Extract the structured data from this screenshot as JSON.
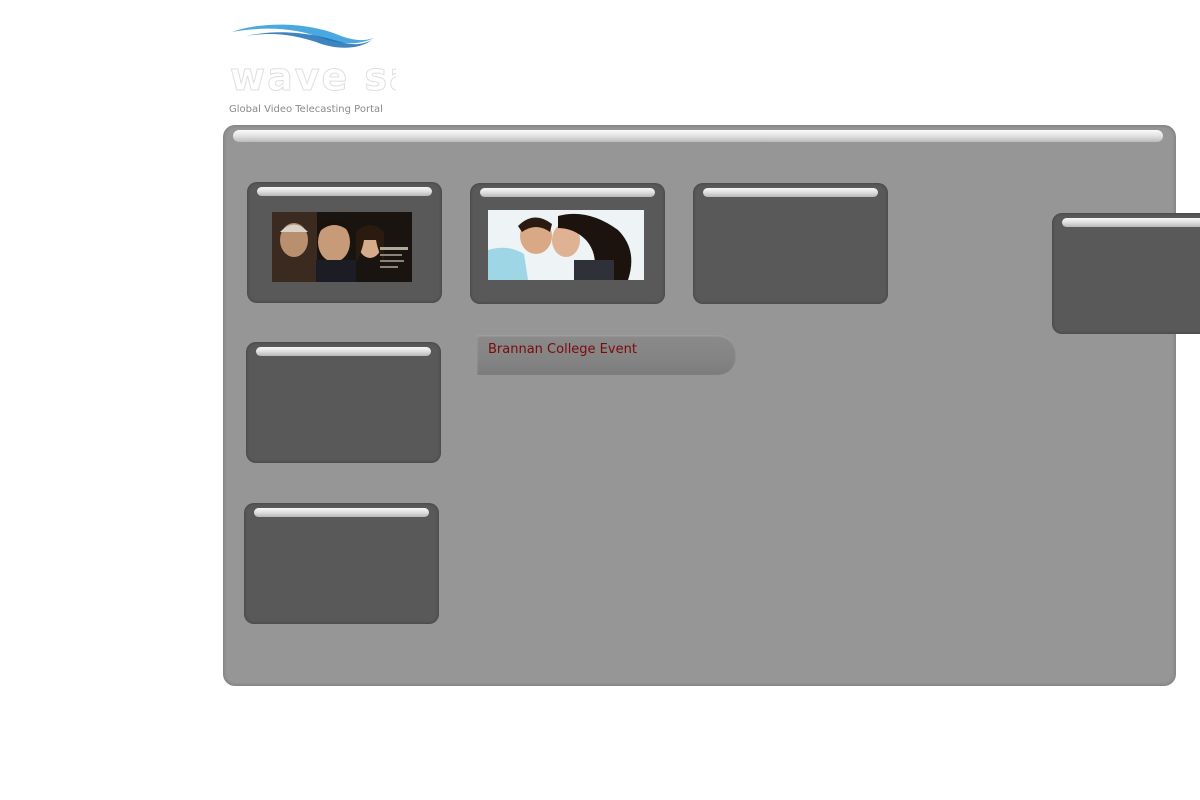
{
  "brand": {
    "logo_text": "wave sat",
    "tagline": "Global Video Telecasting Portal"
  },
  "event": {
    "label": "Brannan College Event"
  },
  "tiles": [
    {
      "name": "video-tile-1",
      "has_thumbnail": true
    },
    {
      "name": "video-tile-2",
      "has_thumbnail": true
    },
    {
      "name": "video-tile-3",
      "has_thumbnail": false
    },
    {
      "name": "video-tile-4",
      "has_thumbnail": false
    },
    {
      "name": "video-tile-5",
      "has_thumbnail": false
    },
    {
      "name": "video-tile-side",
      "has_thumbnail": false
    }
  ],
  "colors": {
    "panel": "#969696",
    "tile": "#595959",
    "event_text": "#7a0a0a",
    "logo_wave": "#2f8fd0"
  }
}
